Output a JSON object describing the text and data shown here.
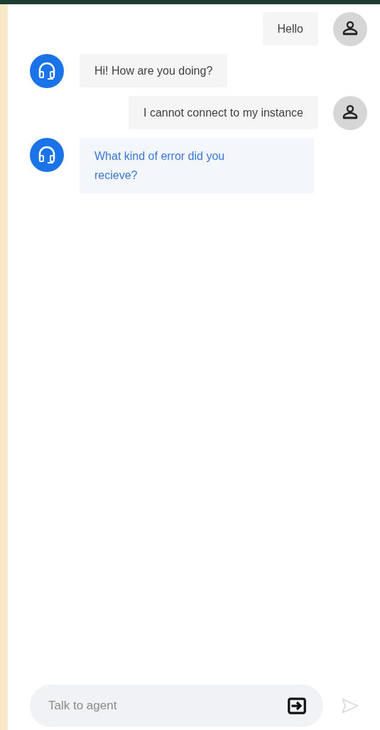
{
  "messages": [
    {
      "kind": "user",
      "text": "Hello",
      "highlighted": false
    },
    {
      "kind": "agent",
      "text": "Hi! How are you doing?",
      "highlighted": false
    },
    {
      "kind": "user",
      "text": "I cannot connect to my instance",
      "highlighted": false
    },
    {
      "kind": "agent",
      "text": "What kind of error did you recieve?",
      "highlighted": true
    }
  ],
  "input": {
    "placeholder": "Talk to agent"
  }
}
